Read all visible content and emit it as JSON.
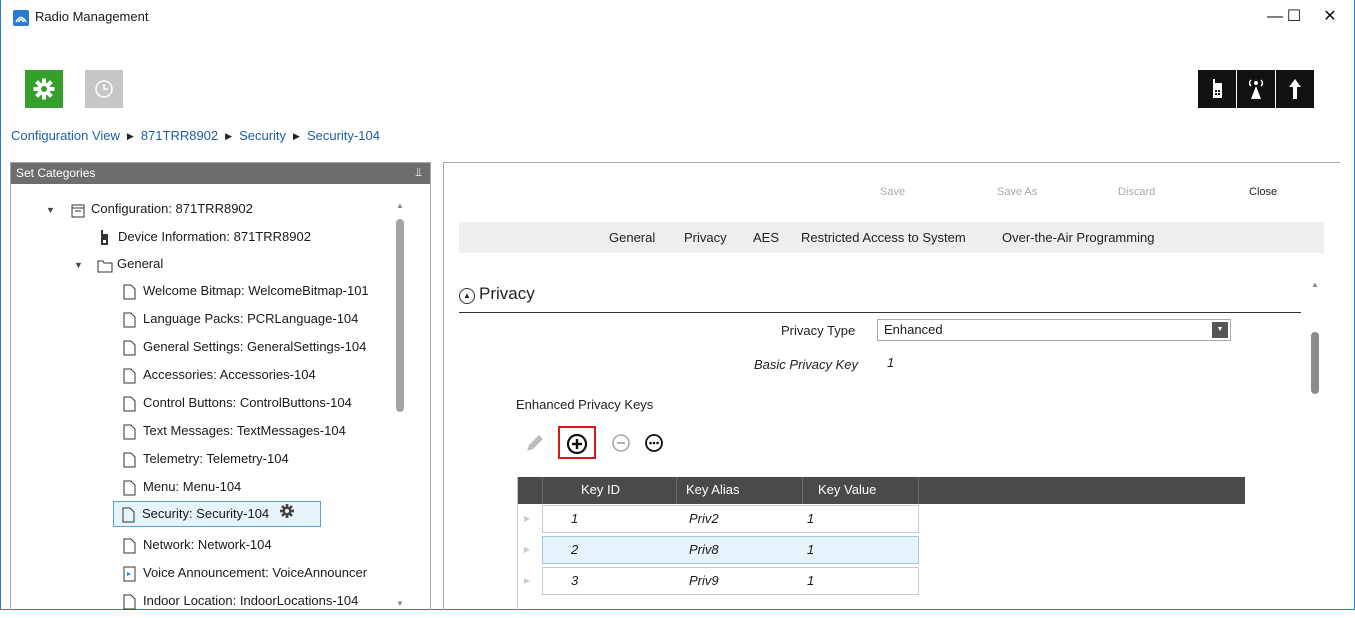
{
  "window": {
    "title": "Radio Management",
    "min": "—",
    "max": "☐",
    "close": "✕"
  },
  "toolbar": {
    "settings": "settings",
    "history": "history",
    "right_buttons": [
      "radio",
      "antenna",
      "upload"
    ]
  },
  "breadcrumb": [
    "Configuration View",
    "871TRR8902",
    "Security",
    "Security-104"
  ],
  "left_panel": {
    "header": "Set Categories",
    "pin": "⫫",
    "tree": [
      {
        "label": "Configuration: 871TRR8902"
      },
      {
        "label": "Device Information: 871TRR8902"
      },
      {
        "label": "General"
      },
      {
        "label": "Welcome Bitmap: WelcomeBitmap-101"
      },
      {
        "label": "Language Packs: PCRLanguage-104"
      },
      {
        "label": "General Settings: GeneralSettings-104"
      },
      {
        "label": "Accessories: Accessories-104"
      },
      {
        "label": "Control Buttons: ControlButtons-104"
      },
      {
        "label": "Text Messages: TextMessages-104"
      },
      {
        "label": "Telemetry: Telemetry-104"
      },
      {
        "label": "Menu: Menu-104"
      },
      {
        "label": "Security: Security-104"
      },
      {
        "label": "Network: Network-104"
      },
      {
        "label": "Voice Announcement: VoiceAnnouncer"
      },
      {
        "label": "Indoor Location: IndoorLocations-104"
      }
    ]
  },
  "actions": {
    "save": "Save",
    "save_as": "Save As",
    "discard": "Discard",
    "close": "Close"
  },
  "tabs": [
    "General",
    "Privacy",
    "AES",
    "Restricted Access to System",
    "Over-the-Air Programming"
  ],
  "privacy": {
    "heading": "Privacy",
    "privacy_type_label": "Privacy Type",
    "privacy_type_value": "Enhanced",
    "basic_key_label": "Basic Privacy Key",
    "basic_key_value": "1",
    "enhanced_keys_label": "Enhanced Privacy Keys"
  },
  "keys_table": {
    "columns": [
      "Key ID",
      "Key Alias",
      "Key Value"
    ],
    "rows": [
      {
        "id": "1",
        "alias": "Priv2",
        "value": "1"
      },
      {
        "id": "2",
        "alias": "Priv8",
        "value": "1"
      },
      {
        "id": "3",
        "alias": "Priv9",
        "value": "1"
      }
    ]
  },
  "colors": {
    "accent_green": "#34a02b",
    "link_blue": "#1d5fa8",
    "highlight_red": "#d7191c"
  }
}
